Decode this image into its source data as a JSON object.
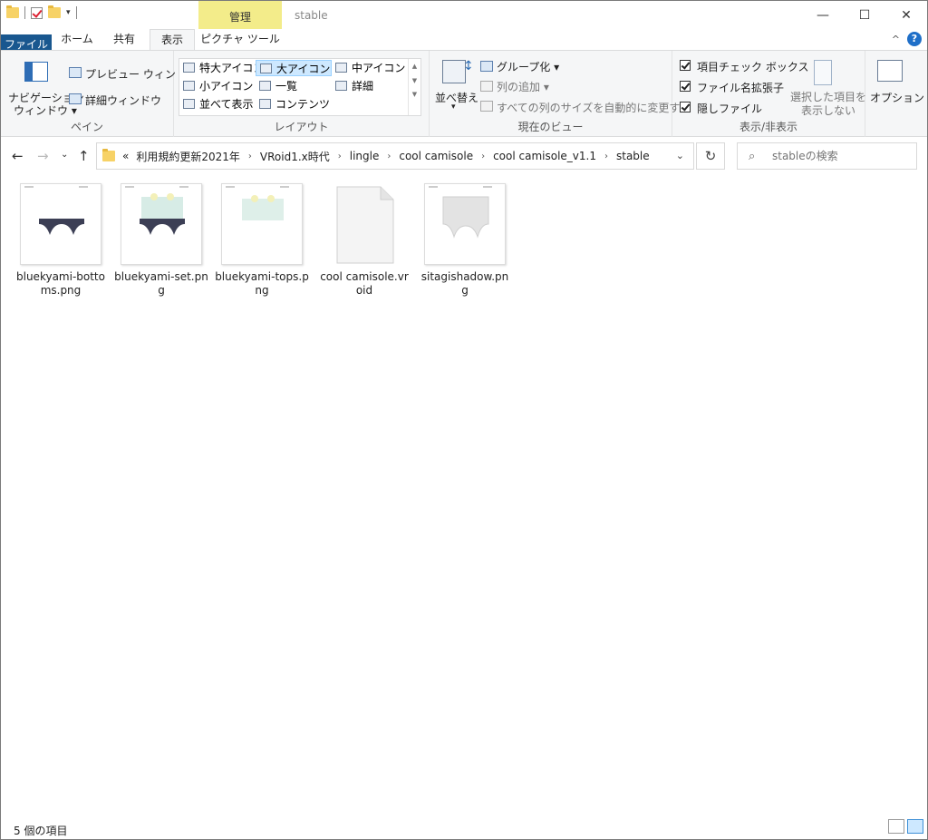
{
  "window": {
    "title": "stable",
    "context_tab": "管理",
    "caption": {
      "minimize": "—",
      "maximize": "☐",
      "close": "✕"
    }
  },
  "tabs": {
    "file": "ファイル",
    "home": "ホーム",
    "share": "共有",
    "view": "表示",
    "picture_tools": "ピクチャ ツール",
    "collapse": "^",
    "help": "?"
  },
  "ribbon": {
    "pane": {
      "nav_line1": "ナビゲーション",
      "nav_line2": "ウィンドウ",
      "preview": "プレビュー ウィンドウ",
      "details": "詳細ウィンドウ",
      "label": "ペイン"
    },
    "layout": {
      "items": [
        "特大アイコン",
        "大アイコン",
        "中アイコン",
        "小アイコン",
        "一覧",
        "詳細",
        "並べて表示",
        "コンテンツ"
      ],
      "selected": "大アイコン",
      "label": "レイアウト"
    },
    "current_view": {
      "sort": "並べ替え",
      "group_by": "グループ化",
      "add_columns": "列の追加",
      "size_columns": "すべての列のサイズを自動的に変更する",
      "label": "現在のビュー"
    },
    "show_hide": {
      "item_checkboxes": "項目チェック ボックス",
      "file_extensions": "ファイル名拡張子",
      "hidden_items": "隠しファイル",
      "hide_selected_line1": "選択した項目を",
      "hide_selected_line2": "表示しない",
      "options": "オプション",
      "label": "表示/非表示"
    }
  },
  "address": {
    "overflow": "«",
    "crumbs": [
      "利用規約更新2021年",
      "VRoid1.x時代",
      "lingle",
      "cool camisole",
      "cool camisole_v1.1",
      "stable"
    ],
    "search_placeholder": "stableの検索"
  },
  "files": [
    {
      "name": "bluekyami-bottoms.png",
      "kind": "bottoms"
    },
    {
      "name": "bluekyami-set.png",
      "kind": "set"
    },
    {
      "name": "bluekyami-tops.png",
      "kind": "tops"
    },
    {
      "name": "cool camisole.vroid",
      "kind": "doc"
    },
    {
      "name": "sitagishadow.png",
      "kind": "shadow"
    }
  ],
  "status": {
    "count": "5 個の項目"
  }
}
